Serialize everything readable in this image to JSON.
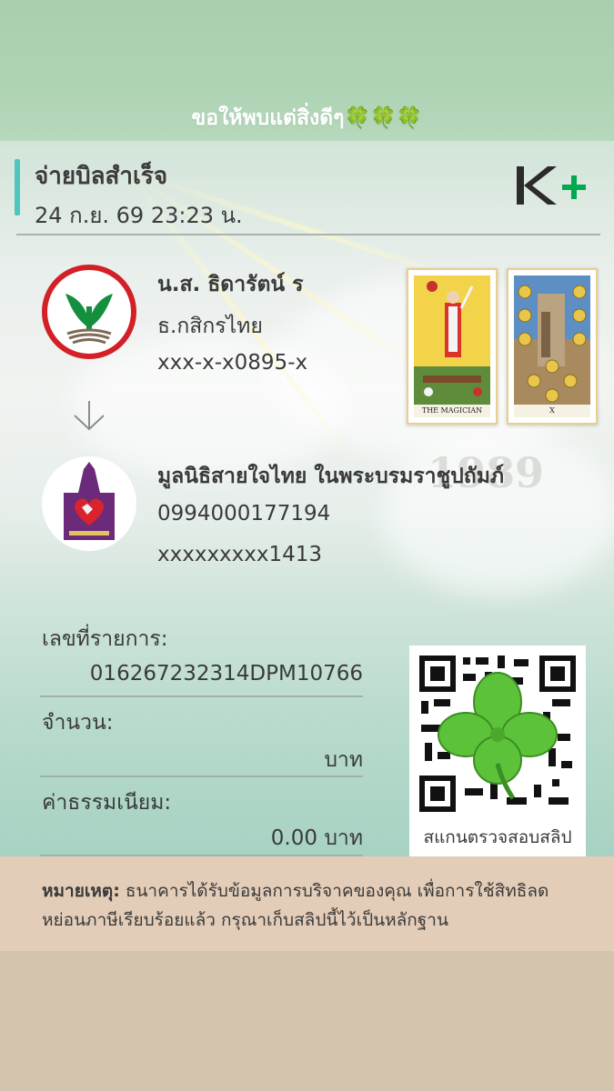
{
  "header": {
    "greeting": "ขอให้พบแต่สิ่งดีๆ🍀🍀🍀"
  },
  "slip": {
    "title": "จ่ายบิลสำเร็จ",
    "datetime": "24 ก.ย. 69  23:23 น.",
    "brand_logo": "K+",
    "sender": {
      "name": "น.ส. ธิดารัตน์ ร",
      "bank": "ธ.กสิกรไทย",
      "account": "xxx-x-x0895-x"
    },
    "receiver": {
      "name": "มูลนิธิสายใจไทย ในพระบรมราชูปถัมภ์",
      "biller_id": "0994000177194",
      "reference": "xxxxxxxxx1413"
    },
    "tarot_cards": [
      {
        "caption": "THE MAGICIAN"
      },
      {
        "caption": "X"
      }
    ],
    "watermark_year": "1989",
    "transaction": {
      "ref_label": "เลขที่รายการ:",
      "ref_value": "016267232314DPM10766",
      "amount_label": "จำนวน:",
      "amount_value": "บาท",
      "fee_label": "ค่าธรรมเนียม:",
      "fee_value": "0.00 บาท"
    },
    "qr": {
      "caption": "สแกนตรวจสอบสลิป"
    }
  },
  "note": {
    "head": "หมายเหตุ:",
    "text": " ธนาคารได้รับข้อมูลการบริจาคของคุณ เพื่อการใช้สิทธิลดหย่อนภาษีเรียบร้อยแล้ว กรุณาเก็บสลิปนี้ไว้เป็นหลักฐาน"
  },
  "colors": {
    "accent_bar": "#4fc6bd",
    "kplus_green": "#00a950",
    "kbank_red": "#d32026",
    "kbank_green": "#138f3e",
    "foundation_purple": "#6b2a7a"
  }
}
